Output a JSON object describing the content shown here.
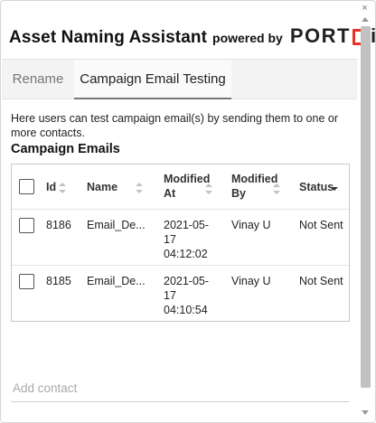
{
  "header": {
    "title": "Asset Naming Assistant",
    "powered_by": "powered by",
    "brand_a": "PORT",
    "brand_b": "ii",
    "close_glyph": "×"
  },
  "tabs": [
    {
      "label": "Rename",
      "active": false
    },
    {
      "label": "Campaign Email Testing",
      "active": true
    }
  ],
  "description": "Here users can test campaign email(s) by sending them to one or more contacts.",
  "section_title": "Campaign Emails",
  "table": {
    "columns": [
      {
        "label": "Id",
        "sort": "none"
      },
      {
        "label": "Name",
        "sort": "none"
      },
      {
        "label": "Modified At",
        "sort": "none"
      },
      {
        "label": "Modified By",
        "sort": "none"
      },
      {
        "label": "Status",
        "sort": "desc"
      }
    ],
    "rows": [
      {
        "id": "8186",
        "name": "Email_De...",
        "modified_at": "2021-05-17 04:12:02",
        "modified_by": "Vinay U",
        "status": "Not Sent"
      },
      {
        "id": "8185",
        "name": "Email_De...",
        "modified_at": "2021-05-17 04:10:54",
        "modified_by": "Vinay U",
        "status": "Not Sent"
      }
    ]
  },
  "add_contact": {
    "placeholder": "Add contact",
    "value": ""
  },
  "colors": {
    "brand_accent": "#e8332a",
    "active_tab_bg": "#fafafa",
    "tab_bar_bg": "#f3f3f3"
  },
  "icons": [
    "close-icon",
    "sort-icon",
    "sort-desc-icon",
    "scroll-up-icon",
    "scroll-down-icon"
  ]
}
